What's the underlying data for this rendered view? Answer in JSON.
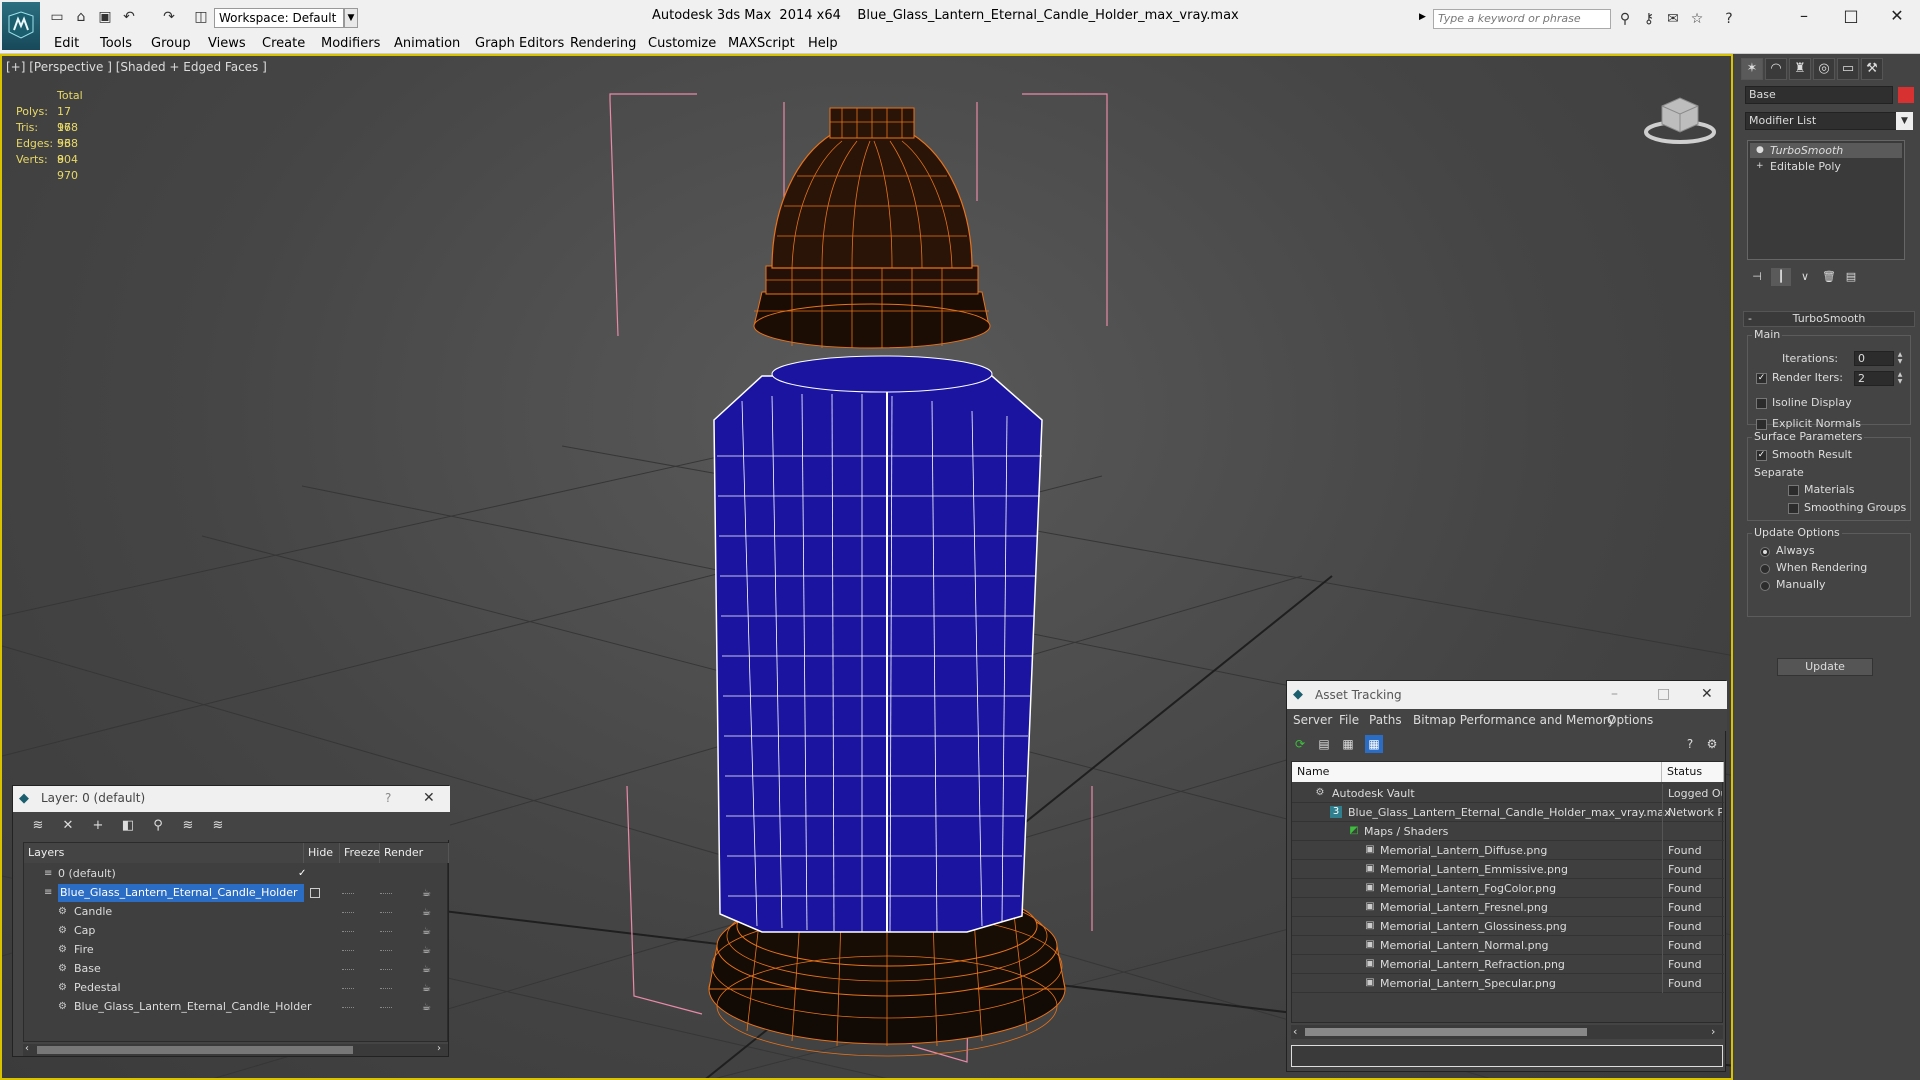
{
  "titlebar": {
    "workspace": "Workspace: Default",
    "app_name": "Autodesk 3ds Max  2014 x64",
    "file_name": "Blue_Glass_Lantern_Eternal_Candle_Holder_max_vray.max",
    "search_placeholder": "Type a keyword or phrase"
  },
  "menu": [
    "Edit",
    "Tools",
    "Group",
    "Views",
    "Create",
    "Modifiers",
    "Animation",
    "Graph Editors",
    "Rendering",
    "Customize",
    "MAXScript",
    "Help"
  ],
  "viewport": {
    "label": "[+] [Perspective ] [Shaded + Edged Faces ]",
    "stats": {
      "header": "Total",
      "rows": [
        {
          "key": "Polys:",
          "value": "17 968"
        },
        {
          "key": "Tris:",
          "value": "17 968"
        },
        {
          "key": "Edges:",
          "value": "53 904"
        },
        {
          "key": "Verts:",
          "value": "8 970"
        }
      ]
    }
  },
  "command_panel": {
    "object_name": "Base",
    "object_color": "#d73131",
    "modifier_list": "Modifier List",
    "stack": [
      "TurboSmooth",
      "Editable Poly"
    ],
    "rollout_title": "TurboSmooth",
    "main_group": "Main",
    "iterations_label": "Iterations:",
    "iterations_value": "0",
    "render_iters_label": "Render Iters:",
    "render_iters_value": "2",
    "isoline": "Isoline Display",
    "explicit_normals": "Explicit Normals",
    "surface_group": "Surface Parameters",
    "smooth_result": "Smooth Result",
    "separate": "Separate",
    "materials": "Materials",
    "smoothing_groups": "Smoothing Groups",
    "update_group": "Update Options",
    "always": "Always",
    "when_rendering": "When Rendering",
    "manually": "Manually",
    "update_button": "Update"
  },
  "layer_window": {
    "title": "Layer: 0 (default)",
    "columns": [
      "Layers",
      "Hide",
      "Freeze",
      "Render"
    ],
    "rows": [
      {
        "name": "0 (default)"
      },
      {
        "name": "Blue_Glass_Lantern_Eternal_Candle_Holder"
      },
      {
        "name": "Candle"
      },
      {
        "name": "Cap"
      },
      {
        "name": "Fire"
      },
      {
        "name": "Base"
      },
      {
        "name": "Pedestal"
      },
      {
        "name": "Blue_Glass_Lantern_Eternal_Candle_Holder"
      }
    ]
  },
  "asset_window": {
    "title": "Asset Tracking",
    "menu": [
      "Server",
      "File",
      "Paths",
      "Bitmap Performance and Memory",
      "Options"
    ],
    "columns": [
      "Name",
      "Status"
    ],
    "rows": [
      {
        "name": "Autodesk Vault",
        "status": "Logged Out"
      },
      {
        "name": "Blue_Glass_Lantern_Eternal_Candle_Holder_max_vray.max",
        "status": "Network Path"
      },
      {
        "name": "Maps / Shaders",
        "status": ""
      },
      {
        "name": "Memorial_Lantern_Diffuse.png",
        "status": "Found"
      },
      {
        "name": "Memorial_Lantern_Emmissive.png",
        "status": "Found"
      },
      {
        "name": "Memorial_Lantern_FogColor.png",
        "status": "Found"
      },
      {
        "name": "Memorial_Lantern_Fresnel.png",
        "status": "Found"
      },
      {
        "name": "Memorial_Lantern_Glossiness.png",
        "status": "Found"
      },
      {
        "name": "Memorial_Lantern_Normal.png",
        "status": "Found"
      },
      {
        "name": "Memorial_Lantern_Refraction.png",
        "status": "Found"
      },
      {
        "name": "Memorial_Lantern_Specular.png",
        "status": "Found"
      }
    ]
  },
  "colors": {
    "wire_orange": "#e8731a",
    "glass_blue": "#1a14a0",
    "selection_blue": "#2b6cc4",
    "viewport_border": "#d9c200"
  }
}
